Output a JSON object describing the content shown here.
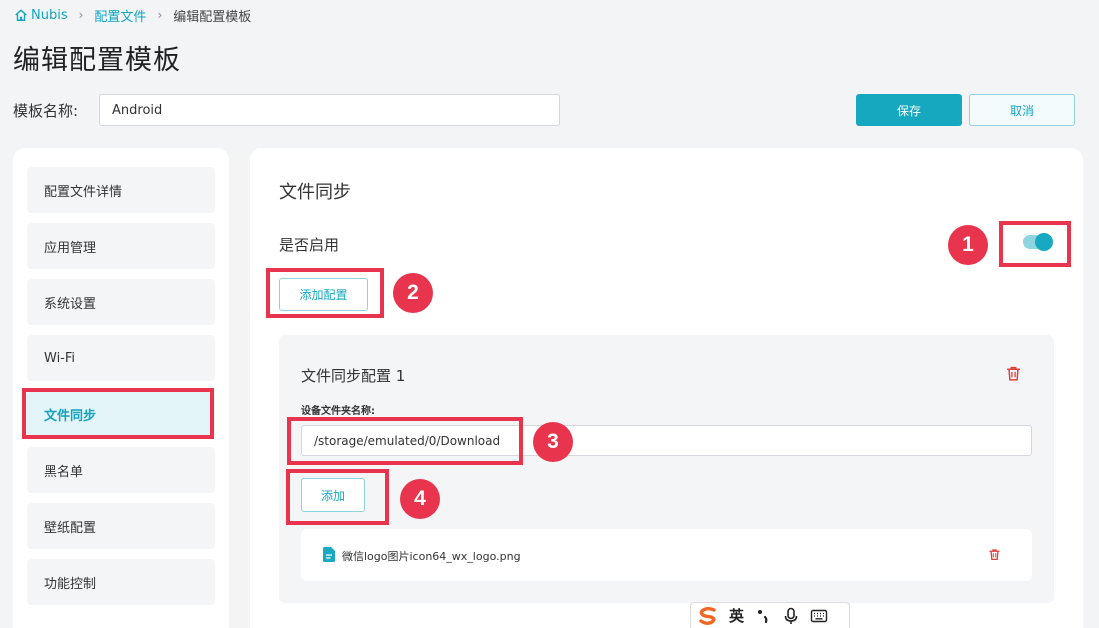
{
  "breadcrumb": {
    "home": "Nubis",
    "level1": "配置文件",
    "current": "编辑配置模板",
    "separator": "›"
  },
  "page": {
    "title": "编辑配置模板"
  },
  "template": {
    "name_label": "模板名称:",
    "name_value": "Android"
  },
  "actions": {
    "save": "保存",
    "cancel": "取消"
  },
  "sidebar": {
    "items": [
      {
        "label": "配置文件详情",
        "active": false
      },
      {
        "label": "应用管理",
        "active": false
      },
      {
        "label": "系统设置",
        "active": false
      },
      {
        "label": "Wi-Fi",
        "active": false
      },
      {
        "label": "文件同步",
        "active": true
      },
      {
        "label": "黑名单",
        "active": false
      },
      {
        "label": "壁纸配置",
        "active": false
      },
      {
        "label": "功能控制",
        "active": false
      }
    ]
  },
  "main": {
    "section_title": "文件同步",
    "enable_label": "是否启用",
    "enabled": true,
    "add_config_label": "添加配置",
    "config": {
      "title": "文件同步配置 1",
      "folder_label": "设备文件夹名称:",
      "folder_value": "/storage/emulated/0/Download",
      "add_label": "添加",
      "files": [
        {
          "name": "微信logo图片icon64_wx_logo.png"
        }
      ]
    }
  },
  "annotations": [
    "1",
    "2",
    "3",
    "4"
  ],
  "ime": {
    "language": "英"
  },
  "colors": {
    "accent": "#16a8bf",
    "annotation": "#e8354d",
    "danger": "#e0403a"
  }
}
